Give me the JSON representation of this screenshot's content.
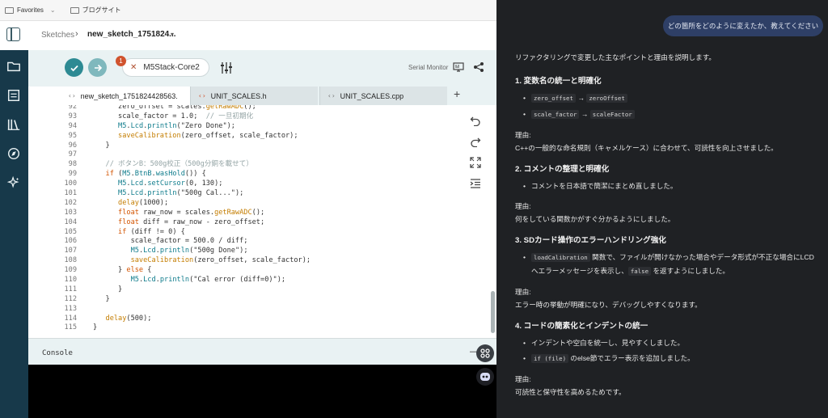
{
  "bookmarks": {
    "favorites": "Favorites",
    "blog": "ブログサイト"
  },
  "header": {
    "crumb_root": "Sketches",
    "crumb_sep": "›",
    "crumb_file": "new_sketch_1751824...",
    "crumb_caret": "▾"
  },
  "toolbar": {
    "board_name": "M5Stack-Core2",
    "board_close": "✕",
    "badge_count": "1",
    "serial_monitor": "Serial Monitor"
  },
  "tabs": [
    {
      "label": "new_sketch_1751824428563.",
      "icon": "‹›"
    },
    {
      "label": "UNIT_SCALES.h",
      "icon": "‹›"
    },
    {
      "label": "UNIT_SCALES.cpp",
      "icon": "‹›"
    }
  ],
  "tab_add": "+",
  "code_lines": [
    {
      "n": "92",
      "html": "      zero_offset = scales.<span class=\"fn\">getRawADC</span>();"
    },
    {
      "n": "93",
      "html": "      scale_factor = <span class=\"num\">1.0</span>;  <span class=\"cm\">// 一旦初期化</span>"
    },
    {
      "n": "94",
      "html": "      <span class=\"obj\">M5</span>.<span class=\"obj\">Lcd</span>.<span class=\"obj\">println</span>(\"Zero Done\");"
    },
    {
      "n": "95",
      "html": "      <span class=\"fn\">saveCalibration</span>(zero_offset, scale_factor);"
    },
    {
      "n": "96",
      "html": "   }"
    },
    {
      "n": "97",
      "html": ""
    },
    {
      "n": "98",
      "html": "   <span class=\"cm\">// ボタンB：500g校正（500g分銅を載せて）</span>"
    },
    {
      "n": "99",
      "html": "   <span class=\"kw\">if</span> (<span class=\"obj\">M5</span>.<span class=\"obj\">BtnB</span>.<span class=\"obj\">wasHold</span>()) {"
    },
    {
      "n": "100",
      "html": "      <span class=\"obj\">M5</span>.<span class=\"obj\">Lcd</span>.<span class=\"obj\">setCursor</span>(0, 130);"
    },
    {
      "n": "101",
      "html": "      <span class=\"obj\">M5</span>.<span class=\"obj\">Lcd</span>.<span class=\"obj\">println</span>(\"500g Cal...\");"
    },
    {
      "n": "102",
      "html": "      <span class=\"fn\">delay</span>(1000);"
    },
    {
      "n": "103",
      "html": "      <span class=\"kw\">float</span> raw_now = scales.<span class=\"fn\">getRawADC</span>();"
    },
    {
      "n": "104",
      "html": "      <span class=\"kw\">float</span> diff = raw_now - zero_offset;"
    },
    {
      "n": "105",
      "html": "      <span class=\"kw\">if</span> (diff != 0) {"
    },
    {
      "n": "106",
      "html": "         scale_factor = 500.0 / diff;"
    },
    {
      "n": "107",
      "html": "         <span class=\"obj\">M5</span>.<span class=\"obj\">Lcd</span>.<span class=\"obj\">println</span>(\"500g Done\");"
    },
    {
      "n": "108",
      "html": "         <span class=\"fn\">saveCalibration</span>(zero_offset, scale_factor);"
    },
    {
      "n": "109",
      "html": "      } <span class=\"kw\">else</span> {"
    },
    {
      "n": "110",
      "html": "         <span class=\"obj\">M5</span>.<span class=\"obj\">Lcd</span>.<span class=\"obj\">println</span>(\"Cal error (diff=0)\");"
    },
    {
      "n": "111",
      "html": "      }"
    },
    {
      "n": "112",
      "html": "   }"
    },
    {
      "n": "113",
      "html": ""
    },
    {
      "n": "114",
      "html": "   <span class=\"fn\">delay</span>(500);"
    },
    {
      "n": "115",
      "html": "}"
    }
  ],
  "console": {
    "label": "Console",
    "minimize": "—"
  },
  "chat": {
    "user_message": "どの箇所をどのように変えたか、教えてください",
    "intro": "リファクタリングで変更した主なポイントと理由を説明します。",
    "reason_label": "理由:",
    "sections": [
      {
        "title": "1. 変数名の統一と明確化",
        "bullets": [
          {
            "a": "zero_offset",
            "arrow": "→",
            "b": "zeroOffset"
          },
          {
            "a": "scale_factor",
            "arrow": "→",
            "b": "scaleFactor"
          }
        ],
        "reason": "C++の一般的な命名規則（キャメルケース）に合わせて、可読性を向上させました。"
      },
      {
        "title": "2. コメントの整理と明確化",
        "bullet_text": "コメントを日本語で簡潔にまとめ直しました。",
        "reason": "何をしている関数かがすぐ分かるようにしました。"
      },
      {
        "title": "3. SDカード操作のエラーハンドリング強化",
        "bullet_code": "loadCalibration",
        "bullet_text_1": " 関数で、ファイルが開けなかった場合やデータ形式が不正な場合にLCD",
        "bullet_text_2": "へエラーメッセージを表示し、",
        "bullet_code_2": "false",
        "bullet_text_3": " を返すようにしました。",
        "reason": "エラー時の挙動が明確になり、デバッグしやすくなります。"
      },
      {
        "title": "4. コードの簡素化とインデントの統一",
        "bullet_text": "インデントや空白を統一し、見やすくしました。",
        "bullet2_code": "if (file)",
        "bullet2_text": " のelse節でエラー表示を追加しました。",
        "reason": "可読性と保守性を高めるためです。"
      }
    ]
  },
  "colors": {
    "accent": "#2d8a93",
    "activity_bar": "#17394a",
    "chat_bg": "#1f2124",
    "user_bubble": "#2e3f66"
  }
}
